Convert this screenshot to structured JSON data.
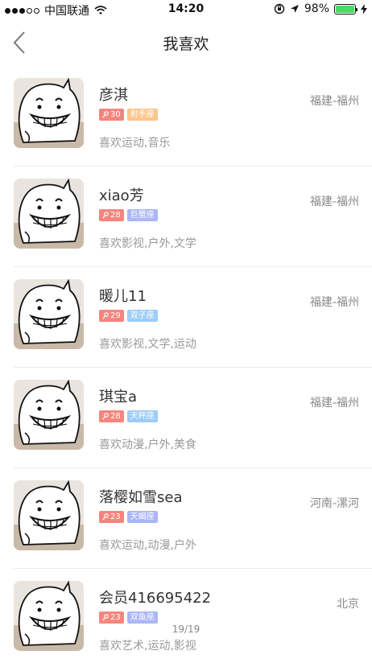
{
  "status_bar": {
    "carrier": "中国联通",
    "time": "14:20",
    "battery": "98%",
    "battery_level": 0.98,
    "signal_dots_filled": 3,
    "signal_dots_total": 5
  },
  "header": {
    "title": "我喜欢",
    "back_icon": "chevron-left-icon"
  },
  "users": [
    {
      "name": "彦淇",
      "age": "30",
      "sign": "射手座",
      "sign_color": "#fcc58a",
      "hobby": "喜欢运动,音乐",
      "location": "福建-福州"
    },
    {
      "name": "xiao芳",
      "age": "28",
      "sign": "巨蟹座",
      "sign_color": "#aab6f5",
      "hobby": "喜欢影视,户外,文学",
      "location": "福建-福州"
    },
    {
      "name": "暖儿11",
      "age": "29",
      "sign": "双子座",
      "sign_color": "#9fcdf7",
      "hobby": "喜欢影视,文学,运动",
      "location": "福建-福州"
    },
    {
      "name": "琪宝a",
      "age": "28",
      "sign": "天秤座",
      "sign_color": "#9fcdf7",
      "hobby": "喜欢动漫,户外,美食",
      "location": "福建-福州"
    },
    {
      "name": "落樱如雪sea",
      "age": "23",
      "sign": "天蝎座",
      "sign_color": "#aab6f5",
      "hobby": "喜欢运动,动漫,户外",
      "location": "河南-漯河"
    },
    {
      "name": "会员416695422",
      "age": "23",
      "sign": "双鱼座",
      "sign_color": "#aab6f5",
      "hobby": "喜欢艺术,运动,影视",
      "location": "北京"
    }
  ],
  "pager": "19/19",
  "colors": {
    "age_badge": "#f6857e",
    "battery_fill": "#4cd964"
  }
}
